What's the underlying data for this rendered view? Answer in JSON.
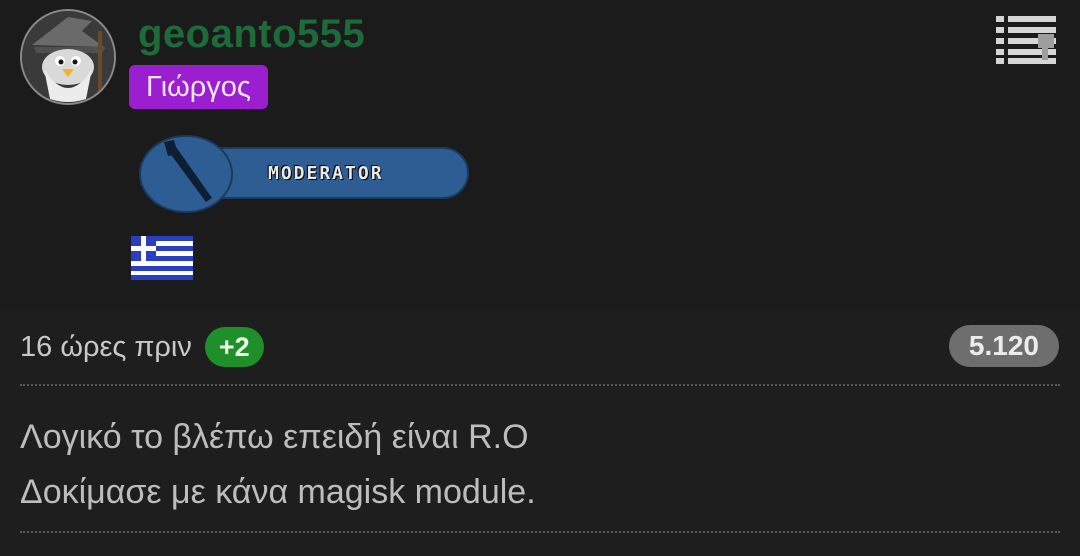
{
  "user": {
    "username": "geoanto555",
    "title": "Γιώργος",
    "badge_label": "MODERATOR",
    "flag_icon": "greece-flag-icon",
    "avatar_icon": "penguin-wizard-avatar"
  },
  "post": {
    "time": "16 ώρες πριν",
    "score": "+2",
    "id": "5.120",
    "lines": [
      "Λογικό το βλέπω επειδή είναι R.O",
      "Δοκίμασε με κάνα magisk module."
    ]
  },
  "colors": {
    "username": "#1d6b3a",
    "title_bg": "#9b1fd1",
    "score_bg": "#1f8f2a",
    "id_bg": "#6e6e6e",
    "badge_bg": "#2d5d92"
  },
  "icons": {
    "menu": "post-menu-icon"
  }
}
